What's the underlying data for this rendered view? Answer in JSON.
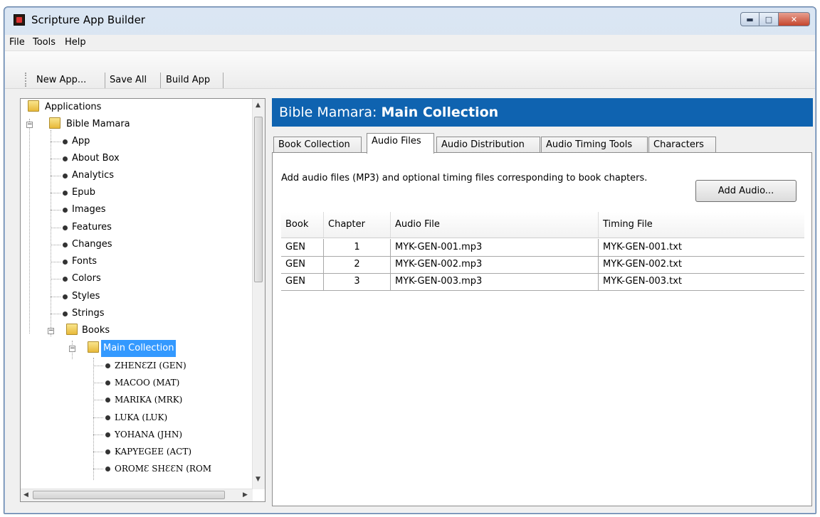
{
  "window": {
    "title": "Scripture App Builder"
  },
  "menu": {
    "file": "File",
    "tools": "Tools",
    "help": "Help"
  },
  "toolbar": {
    "new_app": "New App...",
    "save_all": "Save All",
    "build_app": "Build App"
  },
  "tree": {
    "root": "Applications",
    "app": "Bible Mamara",
    "settings": [
      "App",
      "About Box",
      "Analytics",
      "Epub",
      "Images",
      "Features",
      "Changes",
      "Fonts",
      "Colors",
      "Styles",
      "Strings"
    ],
    "books": "Books",
    "collection": "Main Collection",
    "book_items": [
      "ZHENƐZI (GEN)",
      "MACOO (MAT)",
      "MARIKA (MRK)",
      "LUKA (LUK)",
      "YOHANA (JHN)",
      "KAPYEGEE (ACT)",
      "OROMƐ SHƐƐN (ROM"
    ]
  },
  "header": {
    "prefix": "Bible Mamara: ",
    "title": "Main Collection"
  },
  "tabs": [
    "Book Collection",
    "Audio Files",
    "Audio Distribution",
    "Audio Timing Tools",
    "Characters"
  ],
  "audio": {
    "description": "Add audio files (MP3) and optional timing files corresponding to book chapters.",
    "add_button": "Add Audio...",
    "columns": [
      "Book",
      "Chapter",
      "Audio File",
      "Timing File"
    ],
    "rows": [
      {
        "book": "GEN",
        "chapter": "1",
        "audio": "MYK-GEN-001.mp3",
        "timing": "MYK-GEN-001.txt"
      },
      {
        "book": "GEN",
        "chapter": "2",
        "audio": "MYK-GEN-002.mp3",
        "timing": "MYK-GEN-002.txt"
      },
      {
        "book": "GEN",
        "chapter": "3",
        "audio": "MYK-GEN-003.mp3",
        "timing": "MYK-GEN-003.txt"
      }
    ]
  },
  "colors": {
    "header_band": "#0f63b0",
    "selection": "#3399ff"
  },
  "icons": [
    "app-icon",
    "minimize-icon",
    "maximize-icon",
    "close-icon",
    "folder-icon",
    "bullet-icon",
    "expander-icon",
    "scroll-arrow-icon"
  ]
}
